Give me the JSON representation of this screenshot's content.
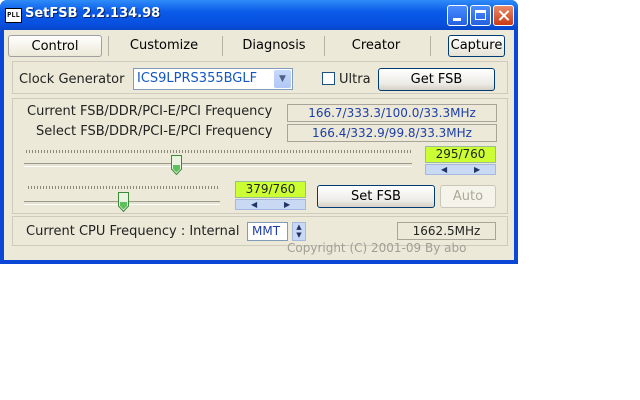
{
  "window": {
    "title": "SetFSB 2.2.134.98",
    "app_icon_text": "PLL"
  },
  "tabs": [
    {
      "label": "Control"
    },
    {
      "label": "Customize"
    },
    {
      "label": "Diagnosis"
    },
    {
      "label": "Creator"
    }
  ],
  "capture_label": "Capture",
  "clock": {
    "label": "Clock Generator",
    "value": "ICS9LPRS355BGLF",
    "ultra_label": "Ultra",
    "ultra_checked": false,
    "get_fsb_label": "Get FSB"
  },
  "freq": {
    "current_label": "Current FSB/DDR/PCI-E/PCI Frequency",
    "current_value": "166.7/333.3/100.0/33.3MHz",
    "select_label": "Select FSB/DDR/PCI-E/PCI Frequency",
    "select_value": "166.4/332.9/99.8/33.3MHz"
  },
  "slider1": {
    "readout": "295/760",
    "position": 295,
    "max": 760
  },
  "slider2": {
    "readout": "379/760",
    "position": 379,
    "max": 760
  },
  "set_fsb_label": "Set FSB",
  "auto_label": "Auto",
  "cpu": {
    "label": "Current CPU Frequency : Internal",
    "mode": "MMT",
    "value": "1662.5MHz"
  },
  "copyright": "Copyright (C) 2001-09 By abo",
  "colors": {
    "titlebar": "#0a5ae8",
    "readout_bg": "#ccff33",
    "value_text": "#1d3ea8"
  }
}
